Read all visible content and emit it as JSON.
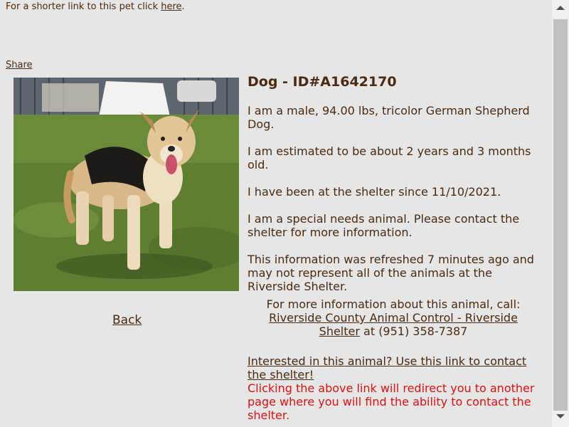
{
  "header": {
    "short_link_text": "For a shorter link to this pet click ",
    "short_link_anchor": "here",
    "short_link_suffix": ".",
    "share_label": "Share"
  },
  "nav": {
    "back_label": "Back"
  },
  "pet": {
    "title": "Dog - ID#A1642170",
    "description": "I am a male, 94.00 lbs, tricolor German Shepherd Dog.",
    "age": "I am estimated to be about 2 years and 3 months old.",
    "since": "I have been at the shelter since 11/10/2021.",
    "special_needs": "I am a special needs animal. Please contact the shelter for more information.",
    "refreshed": "This information was refreshed 7 minutes ago and may not represent all of the animals at the Riverside Shelter.",
    "call_intro": "For more information about this animal, call:",
    "shelter_link": "Riverside County Animal Control - Riverside Shelter",
    "phone": " at (951) 358-7387",
    "contact_link": "Interested in this animal? Use this link to contact the shelter!",
    "redirect_warning": "Clicking the above link will redirect you to another page where you will find the ability to contact the shelter."
  },
  "colors": {
    "text": "#4a2a10",
    "warning": "#e01010",
    "background": "#e6e6e6"
  }
}
